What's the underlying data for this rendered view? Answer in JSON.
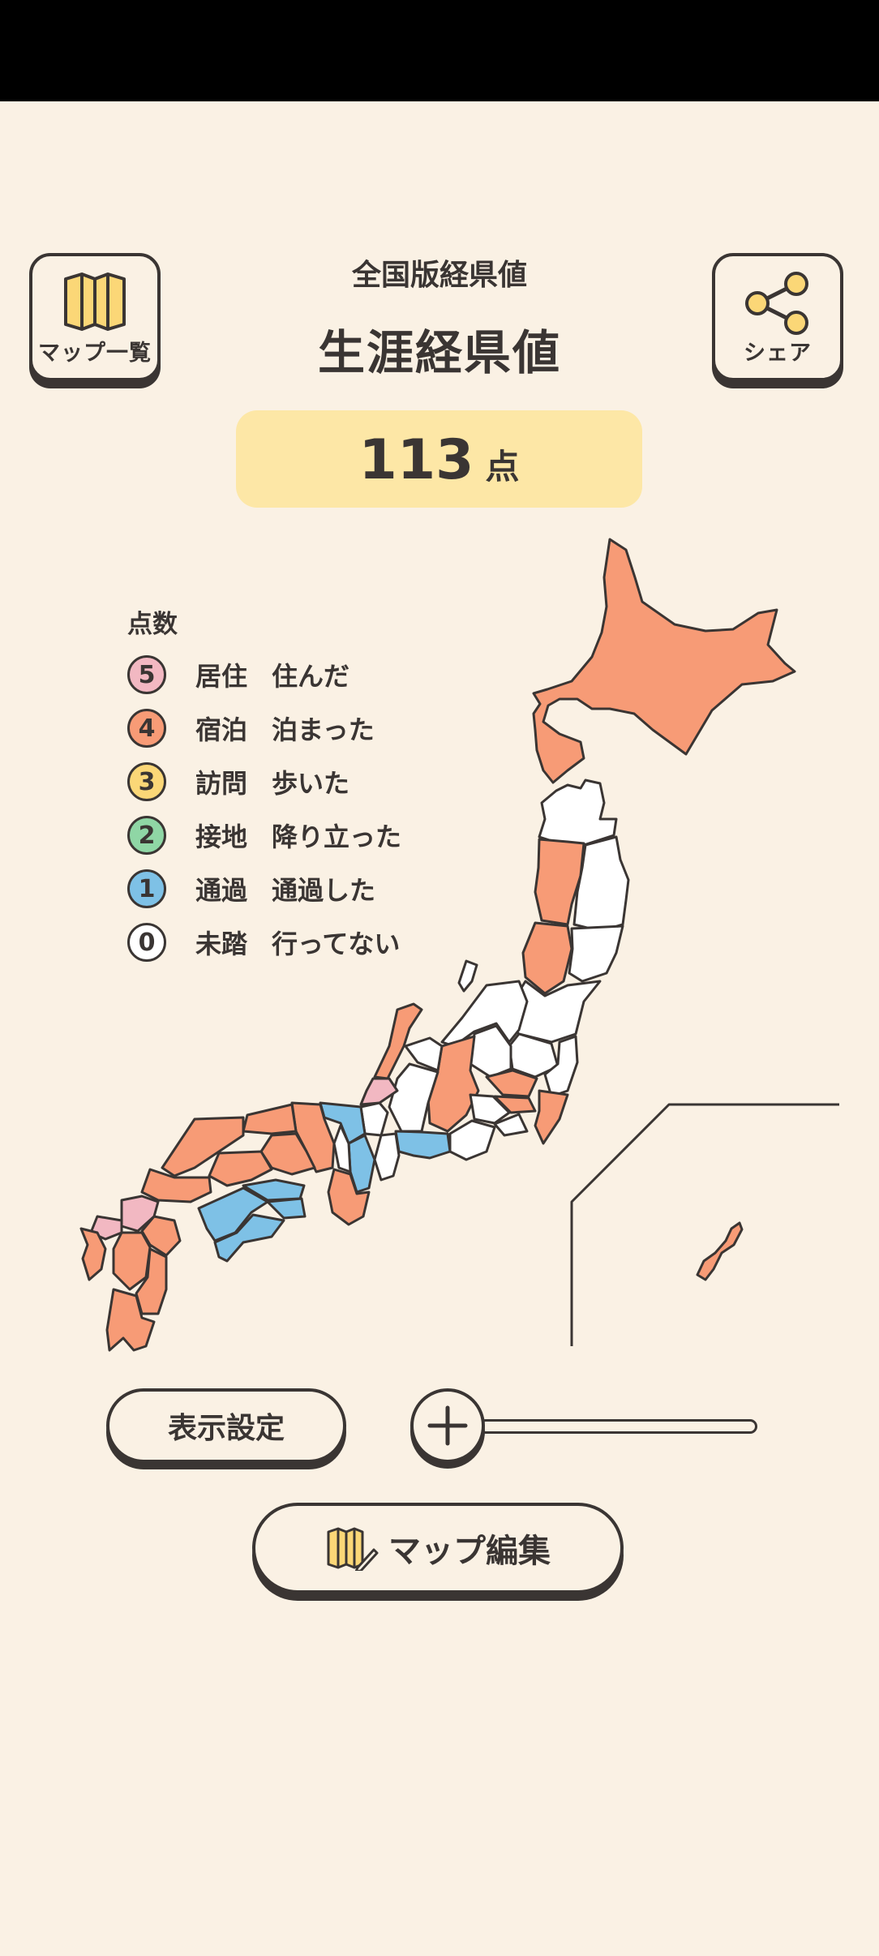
{
  "header": {
    "map_list_label": "マップ一覧",
    "share_label": "シェア",
    "subtitle": "全国版経県値",
    "title": "生涯経県値"
  },
  "score": {
    "value": "113",
    "unit": "点"
  },
  "legend": {
    "title": "点数",
    "items": [
      {
        "score": "5",
        "name": "居住",
        "desc": "住んだ",
        "color": "#f2b8c2"
      },
      {
        "score": "4",
        "name": "宿泊",
        "desc": "泊まった",
        "color": "#f79b76"
      },
      {
        "score": "3",
        "name": "訪問",
        "desc": "歩いた",
        "color": "#fbd777"
      },
      {
        "score": "2",
        "name": "接地",
        "desc": "降り立った",
        "color": "#8fd6a5"
      },
      {
        "score": "1",
        "name": "通過",
        "desc": "通過した",
        "color": "#7ec1e6"
      },
      {
        "score": "0",
        "name": "未踏",
        "desc": "行ってない",
        "color": "#ffffff"
      }
    ]
  },
  "controls": {
    "display_settings_label": "表示設定",
    "zoom_icon": "plus-icon",
    "map_edit_label": "マップ編集",
    "map_edit_icon": "map-pencil-icon"
  },
  "colors": {
    "background": "#faf1e4",
    "score_bg": "#fde7a6",
    "outline": "#3a3533",
    "visited_orange": "#f79b76",
    "passed_blue": "#7ec1e6",
    "lived_pink": "#f2b8c2"
  }
}
